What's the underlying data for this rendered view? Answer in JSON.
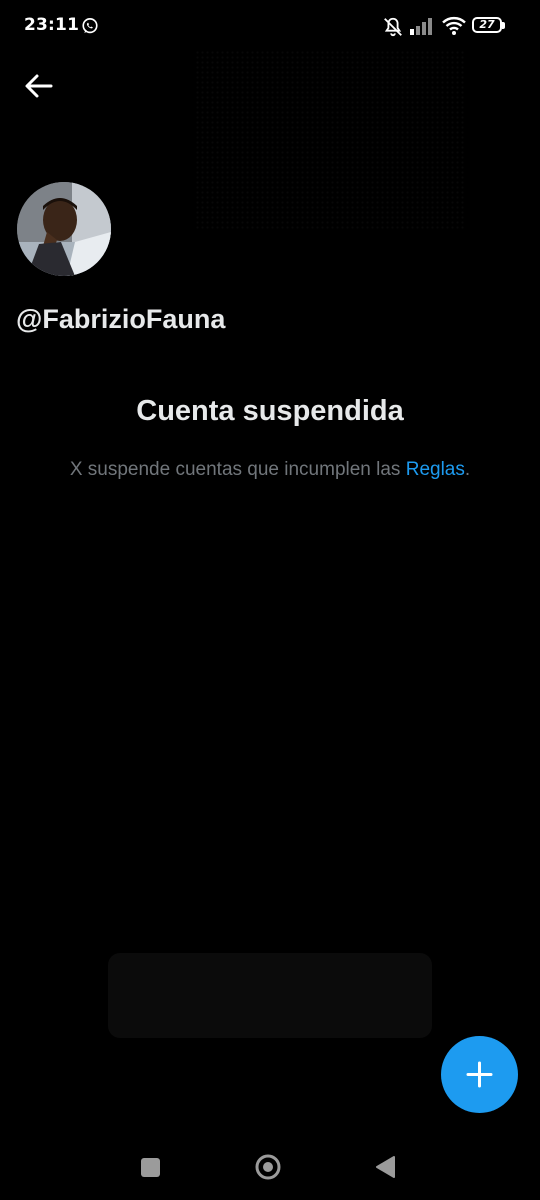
{
  "status_bar": {
    "time": "23:11",
    "battery": "27",
    "icons": [
      "whatsapp-icon",
      "mute-icon",
      "signal-icon",
      "wifi-icon",
      "battery-icon"
    ]
  },
  "profile": {
    "handle": "@FabrizioFauna"
  },
  "suspension": {
    "title": "Cuenta suspendida",
    "text_before": "X suspende cuentas que incumplen las ",
    "link": "Reglas",
    "text_after": "."
  },
  "colors": {
    "background": "#000000",
    "text_primary": "#e7e9ea",
    "text_secondary": "#71767b",
    "accent": "#1d9bf0"
  },
  "fab": {
    "icon": "plus-icon"
  },
  "nav_bar": {
    "icons": [
      "recent-apps-icon",
      "home-icon",
      "back-icon"
    ]
  }
}
